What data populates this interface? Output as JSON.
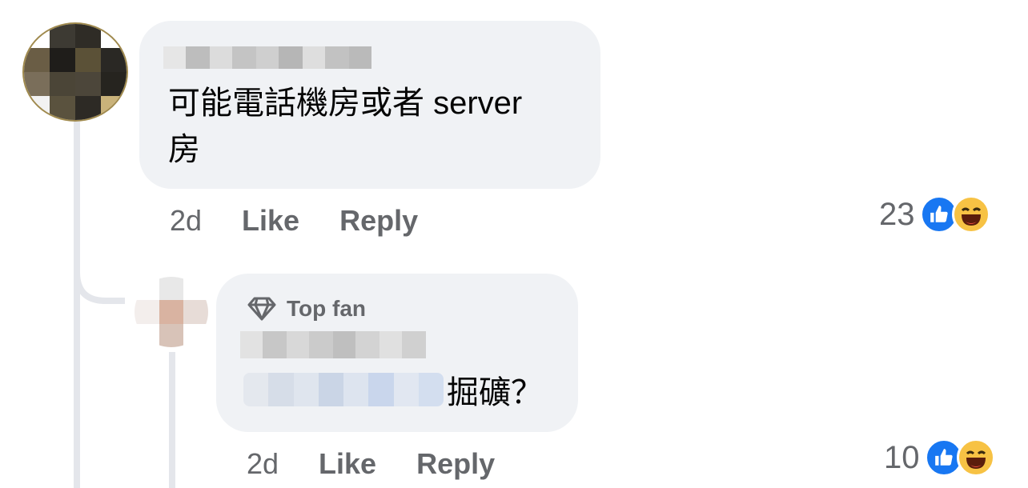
{
  "comment": {
    "text": "可能電話機房或者 server 房",
    "text_line1": "可能電話機房或者 server",
    "text_line2": "房",
    "time": "2d",
    "like_label": "Like",
    "reply_label": "Reply",
    "reaction_count": "23",
    "reactions": [
      "like-icon",
      "haha-icon"
    ]
  },
  "reply": {
    "badge_label": "Top fan",
    "badge_icon": "diamond-icon",
    "text": "掘礦？",
    "time": "2d",
    "like_label": "Like",
    "reply_label": "Reply",
    "reaction_count": "10",
    "reactions": [
      "like-icon",
      "haha-icon"
    ]
  },
  "colors": {
    "bubble": "#f0f2f5",
    "muted_text": "#65676b",
    "like_blue": "#1877f2",
    "haha_yellow": "#f7c244"
  }
}
